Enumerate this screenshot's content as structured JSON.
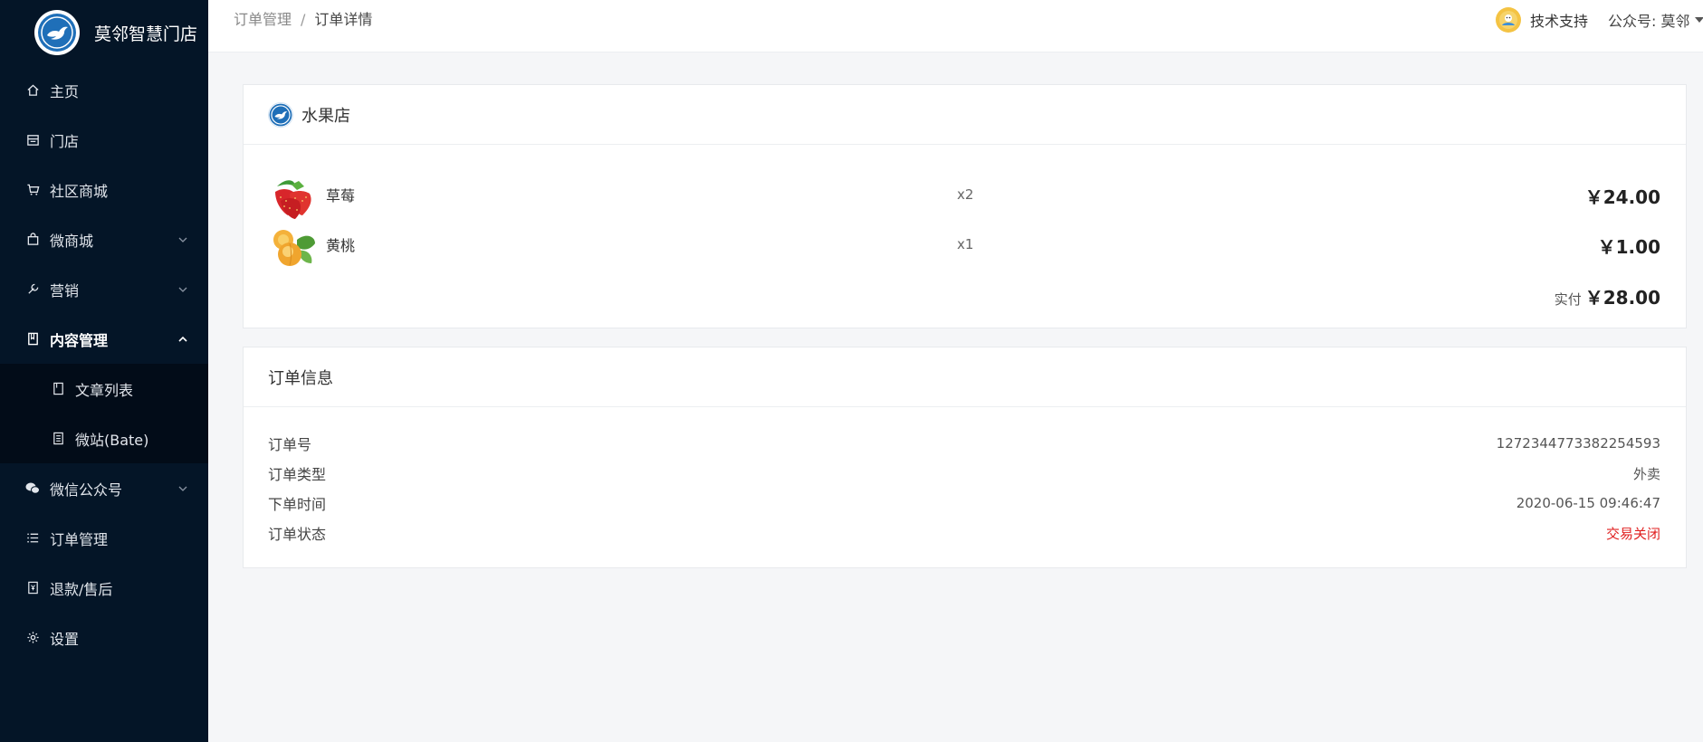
{
  "brand": {
    "name": "莫邻智慧门店",
    "logo_icon": "bird-icon"
  },
  "sidebar": {
    "items": [
      {
        "label": "主页",
        "icon": "home-icon"
      },
      {
        "label": "门店",
        "icon": "store-icon"
      },
      {
        "label": "社区商城",
        "icon": "cart-icon"
      },
      {
        "label": "微商城",
        "icon": "bag-icon"
      },
      {
        "label": "营销",
        "icon": "wrench-icon"
      },
      {
        "label": "内容管理",
        "icon": "book-icon"
      },
      {
        "label": "文章列表",
        "icon": "article-icon"
      },
      {
        "label": "微站(Bate)",
        "icon": "site-icon"
      },
      {
        "label": "微信公众号",
        "icon": "wechat-icon"
      },
      {
        "label": "订单管理",
        "icon": "list-icon"
      },
      {
        "label": "退款/售后",
        "icon": "refund-icon"
      },
      {
        "label": "设置",
        "icon": "gear-icon"
      }
    ]
  },
  "header": {
    "breadcrumb": {
      "parent": "订单管理",
      "separator": "/",
      "current": "订单详情"
    },
    "support": "技术支持",
    "account": "公众号: 莫邻"
  },
  "shop_card": {
    "shop_name": "水果店",
    "goods": [
      {
        "name": "草莓",
        "qty": "x2",
        "price": "￥24.00",
        "thumb": "strawberry"
      },
      {
        "name": "黄桃",
        "qty": "x1",
        "price": "￥1.00",
        "thumb": "peach"
      }
    ],
    "paid_label": "实付",
    "paid_amount": "￥28.00"
  },
  "order_card": {
    "title": "订单信息",
    "rows": [
      {
        "key": "订单号",
        "value": "1272344773382254593"
      },
      {
        "key": "订单类型",
        "value": "外卖"
      },
      {
        "key": "下单时间",
        "value": "2020-06-15 09:46:47"
      },
      {
        "key": "订单状态",
        "value": "交易关闭"
      }
    ]
  },
  "colors": {
    "sidebar_bg": "#041527",
    "submenu_bg": "#020c18",
    "status_closed": "#e02020",
    "brand_blue": "#1f6fb8"
  }
}
